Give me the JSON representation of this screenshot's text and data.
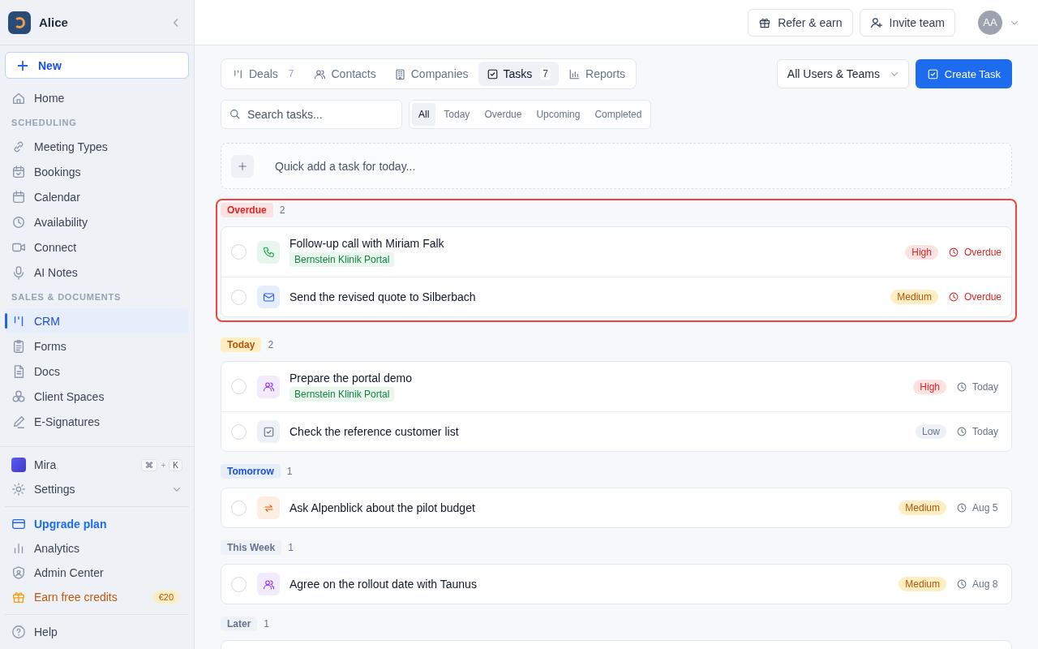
{
  "sidebar": {
    "brand": "Alice",
    "new_button": "New",
    "nav": [
      {
        "kind": "item",
        "label": "Home",
        "selected": false
      },
      {
        "kind": "section",
        "label": "SCHEDULING"
      },
      {
        "kind": "item",
        "label": "Meeting Types",
        "selected": false
      },
      {
        "kind": "item",
        "label": "Bookings",
        "selected": false
      },
      {
        "kind": "item",
        "label": "Calendar",
        "selected": false
      },
      {
        "kind": "item",
        "label": "Availability",
        "selected": false
      },
      {
        "kind": "item",
        "label": "Connect",
        "selected": false
      },
      {
        "kind": "item",
        "label": "AI Notes",
        "selected": false
      },
      {
        "kind": "section",
        "label": "SALES & DOCUMENTS"
      },
      {
        "kind": "item",
        "label": "CRM",
        "selected": true
      },
      {
        "kind": "item",
        "label": "Forms",
        "selected": false
      },
      {
        "kind": "item",
        "label": "Docs",
        "selected": false
      },
      {
        "kind": "item",
        "label": "Client Spaces",
        "selected": false
      },
      {
        "kind": "item",
        "label": "E-Signatures",
        "selected": false
      }
    ],
    "assistant": {
      "label": "Mira",
      "keys": [
        "⌘",
        "+",
        "K"
      ]
    },
    "settings": {
      "label": "Settings",
      "expanded": false
    },
    "footer": [
      {
        "kind": "upgrade",
        "label": "Upgrade plan"
      },
      {
        "kind": "plain",
        "label": "Analytics"
      },
      {
        "kind": "plain",
        "label": "Admin Center"
      },
      {
        "kind": "credits",
        "label": "Earn free credits",
        "badge": "€20"
      }
    ],
    "help": "Help"
  },
  "header": {
    "buttons": [
      "Refer & earn",
      "Invite team"
    ],
    "avatar": "AA"
  },
  "tabs": [
    {
      "label": "Deals",
      "count": "7",
      "selected": false
    },
    {
      "label": "Contacts",
      "selected": false
    },
    {
      "label": "Companies",
      "selected": false
    },
    {
      "label": "Tasks",
      "count": "7",
      "selected": true
    },
    {
      "label": "Reports",
      "selected": false
    }
  ],
  "owner_select": {
    "value": "All Users & Teams"
  },
  "create_button": "Create Task",
  "search": {
    "placeholder": "Search tasks..."
  },
  "filters": [
    {
      "label": "All",
      "selected": true
    },
    {
      "label": "Today",
      "selected": false
    },
    {
      "label": "Overdue",
      "selected": false
    },
    {
      "label": "Upcoming",
      "selected": false
    },
    {
      "label": "Completed",
      "selected": false
    }
  ],
  "quick_add": {
    "placeholder": "Quick add a task for today..."
  },
  "groups": [
    {
      "label": "Overdue",
      "kind": "overdue",
      "count": "2",
      "highlighted": true,
      "tasks": [
        {
          "title": "Follow-up call with Miriam Falk",
          "kind": "call",
          "checked": false,
          "tag": "Bernstein Klinik Portal",
          "priority": {
            "label": "High",
            "kind": "high"
          },
          "due": {
            "label": "Overdue",
            "overdue": true
          }
        },
        {
          "title": "Send the revised quote to Silberbach",
          "kind": "email",
          "checked": false,
          "priority": {
            "label": "Medium",
            "kind": "medium"
          },
          "due": {
            "label": "Overdue",
            "overdue": true
          }
        }
      ]
    },
    {
      "label": "Today",
      "kind": "today",
      "count": "2",
      "highlighted": false,
      "tasks": [
        {
          "title": "Prepare the portal demo",
          "kind": "meeting",
          "checked": false,
          "tag": "Bernstein Klinik Portal",
          "priority": {
            "label": "High",
            "kind": "high"
          },
          "due": {
            "label": "Today",
            "overdue": false
          }
        },
        {
          "title": "Check the reference customer list",
          "kind": "todo",
          "checked": false,
          "priority": {
            "label": "Low",
            "kind": "low"
          },
          "due": {
            "label": "Today",
            "overdue": false
          }
        }
      ]
    },
    {
      "label": "Tomorrow",
      "kind": "tomorrow",
      "count": "1",
      "highlighted": false,
      "tasks": [
        {
          "title": "Ask Alpenblick about the pilot budget",
          "kind": "followup",
          "checked": false,
          "priority": {
            "label": "Medium",
            "kind": "medium"
          },
          "due": {
            "label": "Aug 5",
            "overdue": false
          }
        }
      ]
    },
    {
      "label": "This Week",
      "kind": "neutral",
      "count": "1",
      "highlighted": false,
      "tasks": [
        {
          "title": "Agree on the rollout date with Taunus",
          "kind": "meeting",
          "checked": false,
          "priority": {
            "label": "Medium",
            "kind": "medium"
          },
          "due": {
            "label": "Aug 8",
            "overdue": false
          }
        }
      ]
    },
    {
      "label": "Later",
      "kind": "neutral",
      "count": "1",
      "highlighted": false
    }
  ]
}
